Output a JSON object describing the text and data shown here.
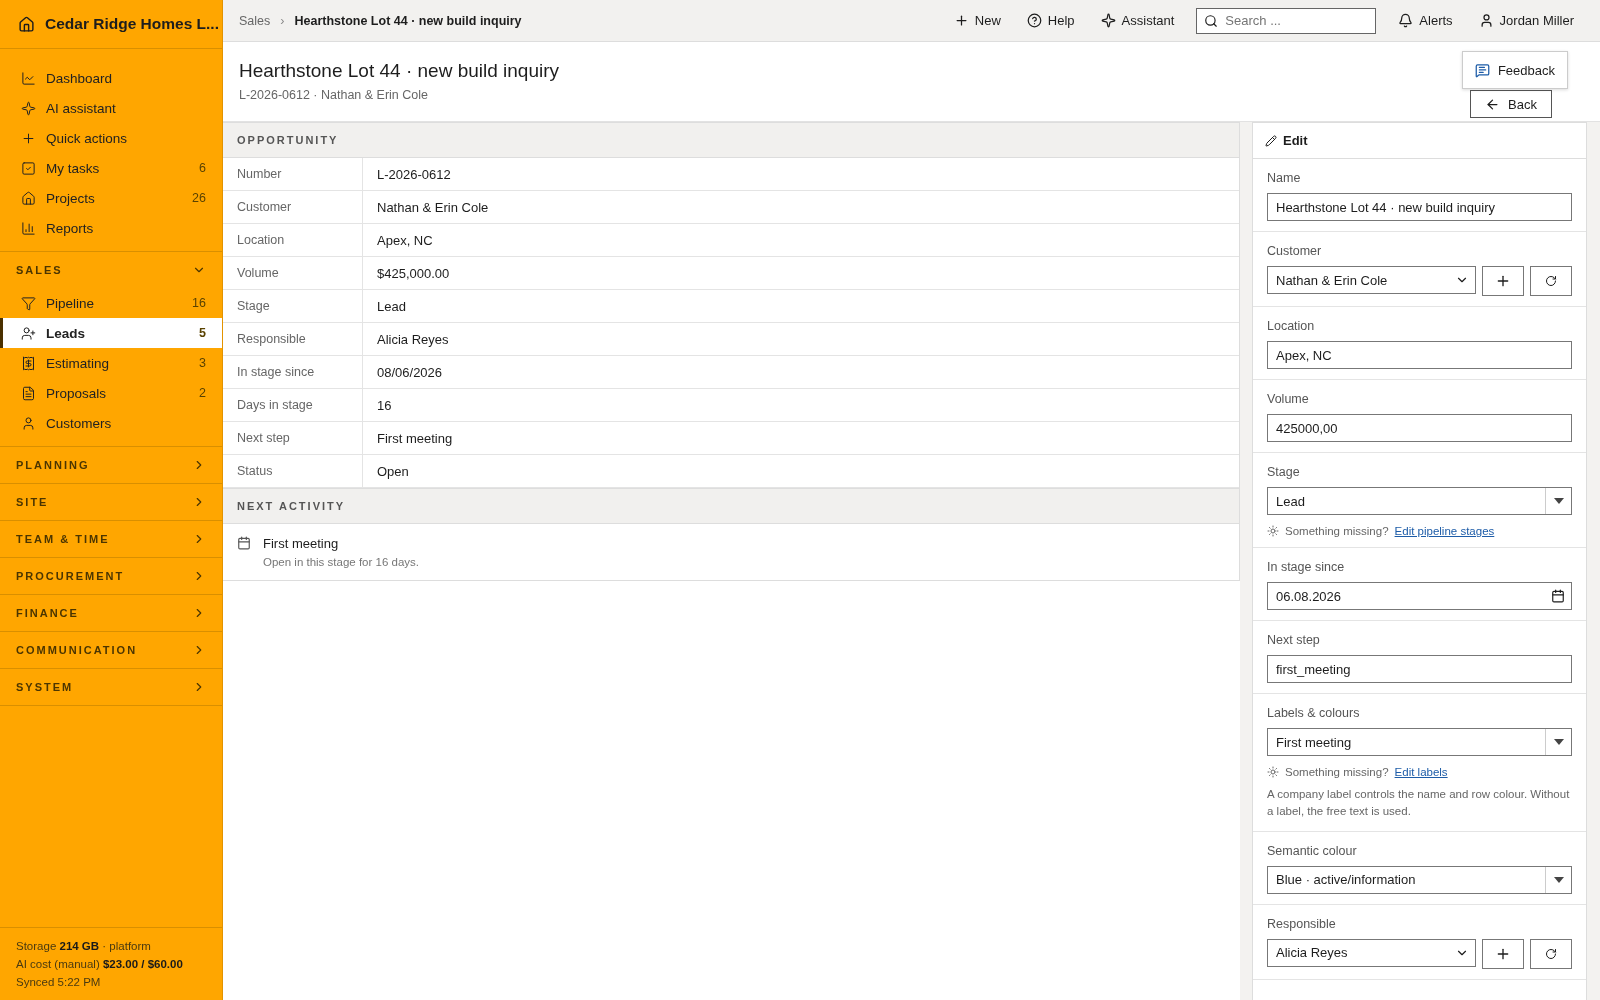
{
  "sidebar": {
    "brand": "Cedar Ridge Homes L...",
    "top_items": [
      {
        "label": "Dashboard",
        "selected": false
      },
      {
        "label": "AI assistant",
        "selected": false
      },
      {
        "label": "Quick actions",
        "selected": false
      },
      {
        "label": "My tasks",
        "count": "6",
        "selected": false
      },
      {
        "label": "Projects",
        "count": "26",
        "selected": false
      },
      {
        "label": "Reports",
        "selected": false
      }
    ],
    "sections": [
      {
        "title": "SALES",
        "expanded": true,
        "items": [
          {
            "label": "Pipeline",
            "count": "16",
            "selected": false
          },
          {
            "label": "Leads",
            "count": "5",
            "selected": true
          },
          {
            "label": "Estimating",
            "count": "3",
            "selected": false
          },
          {
            "label": "Proposals",
            "count": "2",
            "selected": false
          },
          {
            "label": "Customers",
            "selected": false
          }
        ]
      },
      {
        "title": "PLANNING",
        "expanded": false
      },
      {
        "title": "SITE",
        "expanded": false
      },
      {
        "title": "TEAM & TIME",
        "expanded": false
      },
      {
        "title": "PROCUREMENT",
        "expanded": false
      },
      {
        "title": "FINANCE",
        "expanded": false
      },
      {
        "title": "COMMUNICATION",
        "expanded": false
      },
      {
        "title": "SYSTEM",
        "expanded": false
      }
    ],
    "footer": [
      "Storage **214 GB** · platform",
      "AI cost (manual) **$23.00 / $60.00**",
      "Synced 5:22 PM"
    ]
  },
  "topbar": {
    "breadcrumb": [
      "Sales",
      "Hearthstone Lot 44 · new build inquiry"
    ],
    "separator": "›",
    "actions": [
      "New",
      "Help",
      "Assistant"
    ],
    "search": {
      "placeholder": "Search ..."
    },
    "alerts": "Alerts",
    "user": "Jordan Miller"
  },
  "header": {
    "title": "Hearthstone Lot 44 · new build inquiry",
    "subtitle": "L-2026-0612 · Nathan & Erin Cole",
    "feedback": "Feedback",
    "back": "Back"
  },
  "opportunity": {
    "title": "OPPORTUNITY",
    "rows": [
      {
        "label": "Number",
        "value": "L-2026-0612"
      },
      {
        "label": "Customer",
        "value": "Nathan & Erin Cole"
      },
      {
        "label": "Location",
        "value": "Apex, NC"
      },
      {
        "label": "Volume",
        "value": "$425,000.00"
      },
      {
        "label": "Stage",
        "value": "Lead"
      },
      {
        "label": "Responsible",
        "value": "Alicia Reyes"
      },
      {
        "label": "In stage since",
        "value": "08/06/2026"
      },
      {
        "label": "Days in stage",
        "value": "16"
      },
      {
        "label": "Next step",
        "value": "First meeting"
      },
      {
        "label": "Status",
        "value": "Open"
      }
    ]
  },
  "next_activity": {
    "title": "NEXT ACTIVITY",
    "name": "First meeting",
    "detail": "Open in this stage for 16 days."
  },
  "edit": {
    "title": "Edit",
    "fields": [
      {
        "kind": "text",
        "label": "Name",
        "value": "Hearthstone Lot 44 · new build inquiry"
      },
      {
        "kind": "combo",
        "label": "Customer",
        "value": "Nathan & Erin Cole"
      },
      {
        "kind": "text",
        "label": "Location",
        "value": "Apex, NC"
      },
      {
        "kind": "text",
        "label": "Volume",
        "value": "425000,00"
      },
      {
        "kind": "dropdown",
        "label": "Stage",
        "value": "Lead",
        "hint": "Something missing?",
        "link": "Edit pipeline stages"
      },
      {
        "kind": "date",
        "label": "In stage since",
        "value": "06.08.2026"
      },
      {
        "kind": "text",
        "label": "Next step",
        "value": "first_meeting"
      },
      {
        "kind": "dropdown",
        "label": "Labels & colours",
        "value": "First meeting",
        "hint": "Something missing?",
        "link": "Edit labels",
        "note": "A company label controls the name and row colour. Without a label, the free text is used."
      },
      {
        "kind": "dropdown",
        "label": "Semantic colour",
        "value": "Blue · active/information"
      },
      {
        "kind": "combo",
        "label": "Responsible",
        "value": "Alicia Reyes"
      }
    ]
  }
}
